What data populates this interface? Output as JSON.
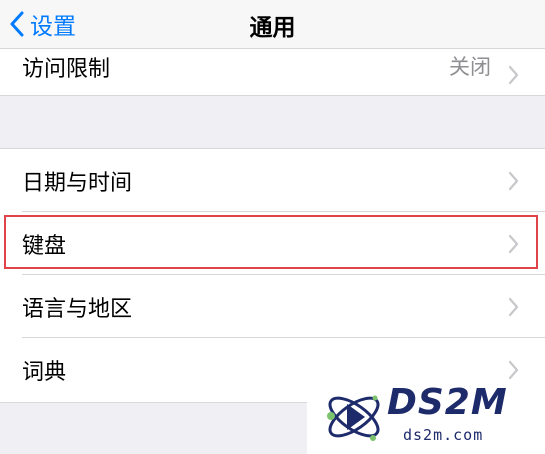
{
  "navbar": {
    "back_label": "设置",
    "title": "通用"
  },
  "top_group": {
    "items": [
      {
        "label": "访问限制",
        "value": "关闭"
      }
    ]
  },
  "main_group": {
    "items": [
      {
        "label": "日期与时间"
      },
      {
        "label": "键盘",
        "highlighted": true
      },
      {
        "label": "语言与地区"
      },
      {
        "label": "词典"
      }
    ]
  },
  "highlight_color": "#e0434a",
  "accent_color": "#007aff",
  "watermark": {
    "text": "DS2M",
    "url": "ds2m.com"
  }
}
